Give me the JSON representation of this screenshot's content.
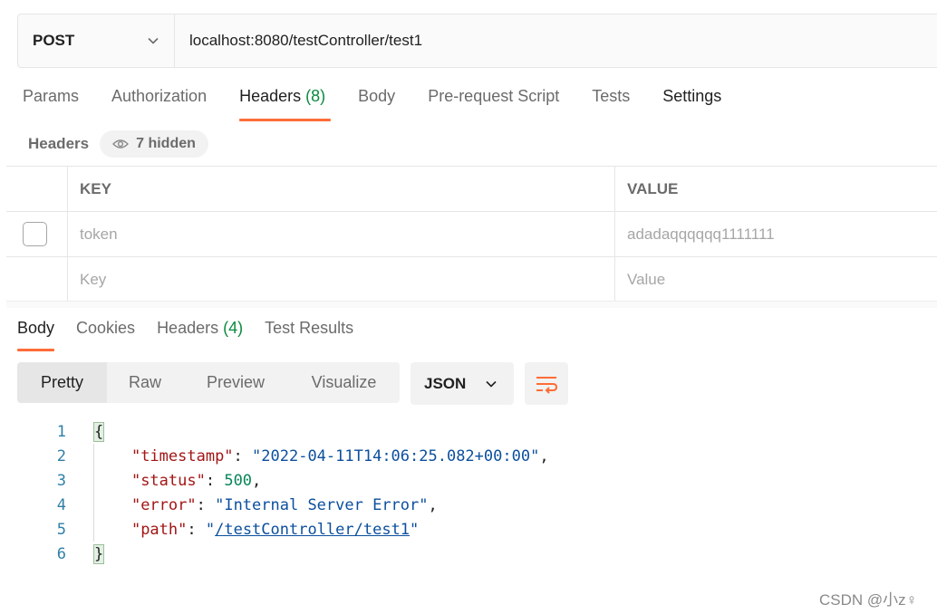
{
  "request": {
    "method": "POST",
    "url": "localhost:8080/testController/test1"
  },
  "request_tabs": [
    {
      "label": "Params"
    },
    {
      "label": "Authorization"
    },
    {
      "label": "Headers",
      "count": "(8)"
    },
    {
      "label": "Body"
    },
    {
      "label": "Pre-request Script"
    },
    {
      "label": "Tests"
    },
    {
      "label": "Settings"
    }
  ],
  "headers_section": {
    "label": "Headers",
    "hidden_label": "7 hidden"
  },
  "header_table": {
    "columns": [
      "KEY",
      "VALUE"
    ],
    "rows": [
      {
        "key": "token",
        "value": "adadaqqqqqq1111111"
      }
    ],
    "placeholder_key": "Key",
    "placeholder_value": "Value"
  },
  "response_tabs": [
    {
      "label": "Body"
    },
    {
      "label": "Cookies"
    },
    {
      "label": "Headers",
      "count": "(4)"
    },
    {
      "label": "Test Results"
    }
  ],
  "format_buttons": [
    "Pretty",
    "Raw",
    "Preview",
    "Visualize"
  ],
  "language": "JSON",
  "code": {
    "line_numbers": [
      "1",
      "2",
      "3",
      "4",
      "5",
      "6"
    ],
    "open_brace": "{",
    "close_brace": "}",
    "fields": [
      {
        "key": "\"timestamp\"",
        "value": "\"2022-04-11T14:06:25.082+00:00\""
      },
      {
        "key": "\"status\"",
        "value": "500"
      },
      {
        "key": "\"error\"",
        "value": "\"Internal Server Error\""
      },
      {
        "key": "\"path\"",
        "value_prefix": "\"",
        "value_link": "/testController/test1",
        "value_suffix": "\""
      }
    ]
  },
  "watermark": "CSDN @小z♀",
  "colors": {
    "accent": "#ff6c37",
    "count_green": "#0c8a3e"
  },
  "icons": [
    "chevron-down-icon",
    "eye-icon",
    "wrap-lines-icon"
  ]
}
